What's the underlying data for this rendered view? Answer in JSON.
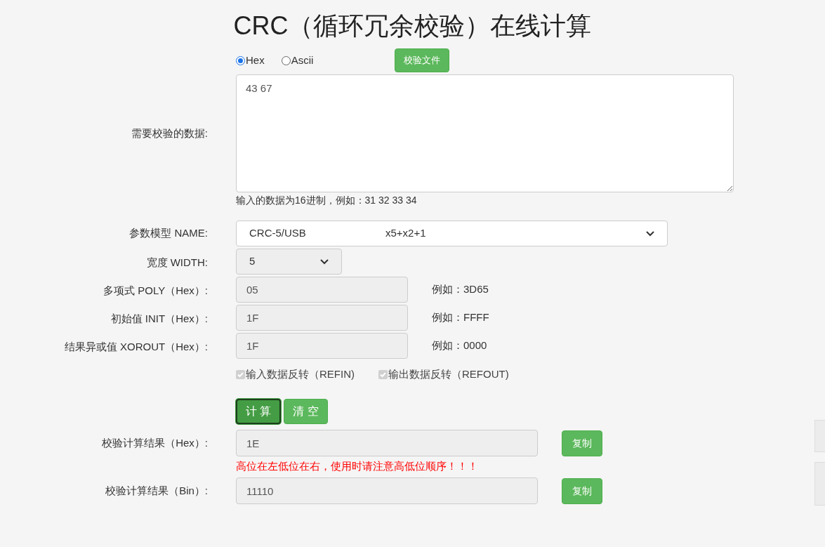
{
  "title": "CRC（循环冗余校验）在线计算",
  "input_format": [
    {
      "label": "Hex",
      "selected": true
    },
    {
      "label": "Ascii",
      "selected": false
    }
  ],
  "file_button": "校验文件",
  "data": {
    "label": "需要校验的数据:",
    "value": "43 67",
    "hint": "输入的数据为16进制，例如：31 32 33 34"
  },
  "model": {
    "label": "参数模型 NAME:",
    "name": "CRC-5/USB",
    "formula": "x5+x2+1"
  },
  "width": {
    "label": "宽度 WIDTH:",
    "value": "5"
  },
  "params": [
    {
      "label": "多项式 POLY（Hex）:",
      "value": "05",
      "example": "例如：3D65"
    },
    {
      "label": "初始值 INIT（Hex）:",
      "value": "1F",
      "example": "例如：FFFF"
    },
    {
      "label": "结果异或值 XOROUT（Hex）:",
      "value": "1F",
      "example": "例如：0000"
    }
  ],
  "reflect": [
    {
      "label": "输入数据反转（REFIN)",
      "checked": true,
      "disabled": true
    },
    {
      "label": "输出数据反转（REFOUT)",
      "checked": true,
      "disabled": true
    }
  ],
  "actions": [
    {
      "label": "计 算",
      "selected": true
    },
    {
      "label": "清 空",
      "selected": false
    }
  ],
  "results": [
    {
      "label": "校验计算结果（Hex）:",
      "value": "1E",
      "copy": "复制",
      "warning": "高位在左低位在右，使用时请注意高低位顺序！！！"
    },
    {
      "label": "校验计算结果（Bin）:",
      "value": "11110",
      "copy": "复制"
    }
  ]
}
